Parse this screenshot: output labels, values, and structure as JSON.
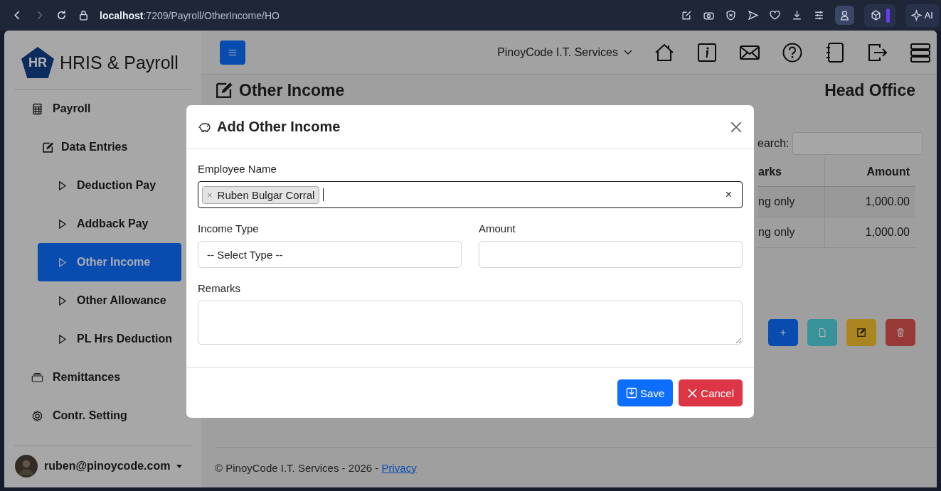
{
  "browser": {
    "url_host": "localhost",
    "url_path": ":7209/Payroll/OtherIncome/HO",
    "ai_label": "AI"
  },
  "sidebar": {
    "logo": "HR",
    "brand": "HRIS & Payroll",
    "menu": [
      {
        "label": "Payroll",
        "selected": false,
        "children": [
          {
            "label": "Data Entries",
            "selected": false,
            "children": [
              {
                "label": "Deduction Pay",
                "selected": false
              },
              {
                "label": "Addback Pay",
                "selected": false
              },
              {
                "label": "Other Income",
                "selected": true
              },
              {
                "label": "Other Allowance",
                "selected": false
              },
              {
                "label": "PL Hrs Deduction",
                "selected": false
              }
            ]
          }
        ]
      },
      {
        "label": "Remittances",
        "selected": false
      },
      {
        "label": "Contr. Setting",
        "selected": false
      }
    ],
    "user": "ruben@pinoycode.com"
  },
  "navbar": {
    "company": "PinoyCode I.T. Services"
  },
  "page": {
    "title": "Other Income",
    "branch": "Head Office",
    "search_label": "earch:",
    "columns": [
      "arks",
      "Amount"
    ],
    "rows": [
      [
        "ng only",
        "1,000.00"
      ],
      [
        "ng only",
        "1,000.00"
      ]
    ]
  },
  "modal": {
    "title": "Add Other Income",
    "employee_label": "Employee Name",
    "employee_tags": [
      "Ruben Bulgar Corral"
    ],
    "tag_remove": "×",
    "clear": "×",
    "income_type_label": "Income Type",
    "income_type_value": "-- Select Type --",
    "amount_label": "Amount",
    "remarks_label": "Remarks",
    "buttons": [
      {
        "label": "Save",
        "kind": "save"
      },
      {
        "label": "Cancel",
        "kind": "cancel"
      }
    ]
  },
  "footer": {
    "text": "© PinoyCode I.T. Services - 2026 - ",
    "link": "Privacy"
  }
}
